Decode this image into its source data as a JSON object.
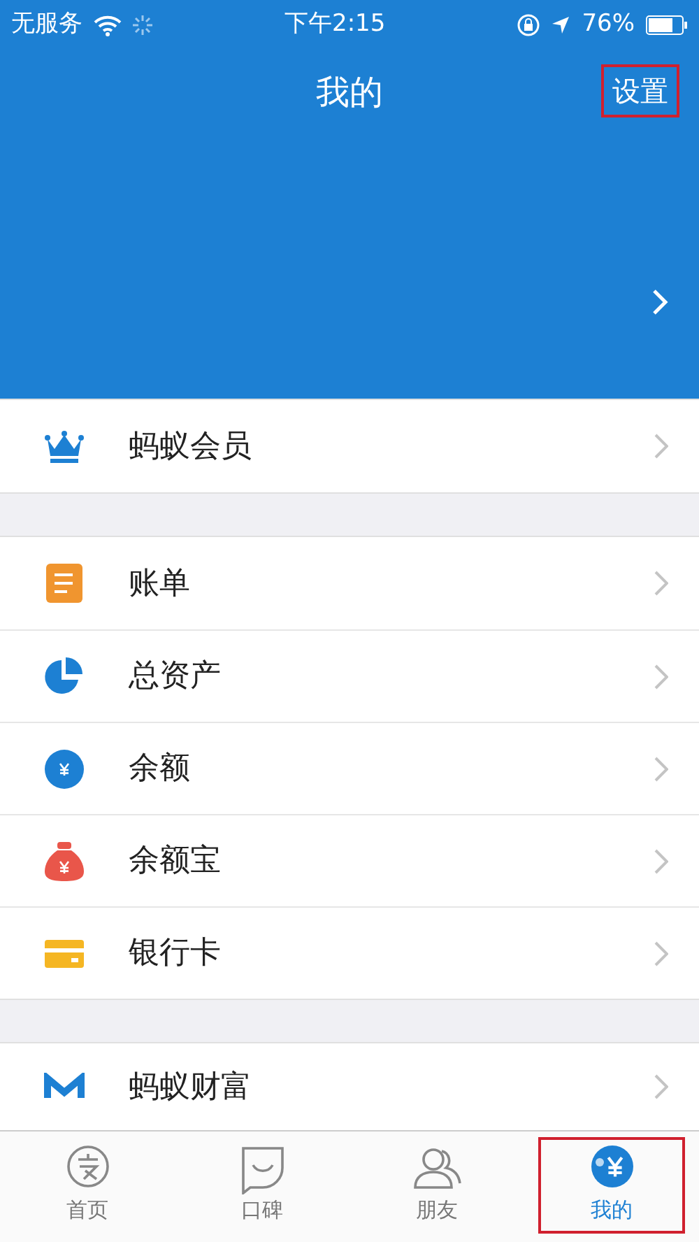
{
  "status_bar": {
    "carrier": "无服务",
    "time": "下午2:15",
    "battery": "76%"
  },
  "header": {
    "title": "我的",
    "settings": {
      "label": "设置",
      "highlighted": true
    }
  },
  "sections": [
    {
      "items": [
        {
          "label": "蚂蚁会员",
          "kind": "crown"
        }
      ]
    },
    {
      "items": [
        {
          "label": "账单",
          "kind": "bill"
        },
        {
          "label": "总资产",
          "kind": "pie"
        },
        {
          "label": "余额",
          "kind": "coin"
        },
        {
          "label": "余额宝",
          "kind": "bag"
        },
        {
          "label": "银行卡",
          "kind": "card"
        }
      ]
    },
    {
      "items": [
        {
          "label": "蚂蚁财富",
          "kind": "fortune"
        }
      ]
    }
  ],
  "tabs": [
    {
      "label": "首页",
      "kind": "home",
      "selected": false,
      "highlighted": false
    },
    {
      "label": "口碑",
      "kind": "koubei",
      "selected": false,
      "highlighted": false
    },
    {
      "label": "朋友",
      "kind": "friends",
      "selected": false,
      "highlighted": false
    },
    {
      "label": "我的",
      "kind": "mine",
      "selected": true,
      "highlighted": true
    }
  ]
}
